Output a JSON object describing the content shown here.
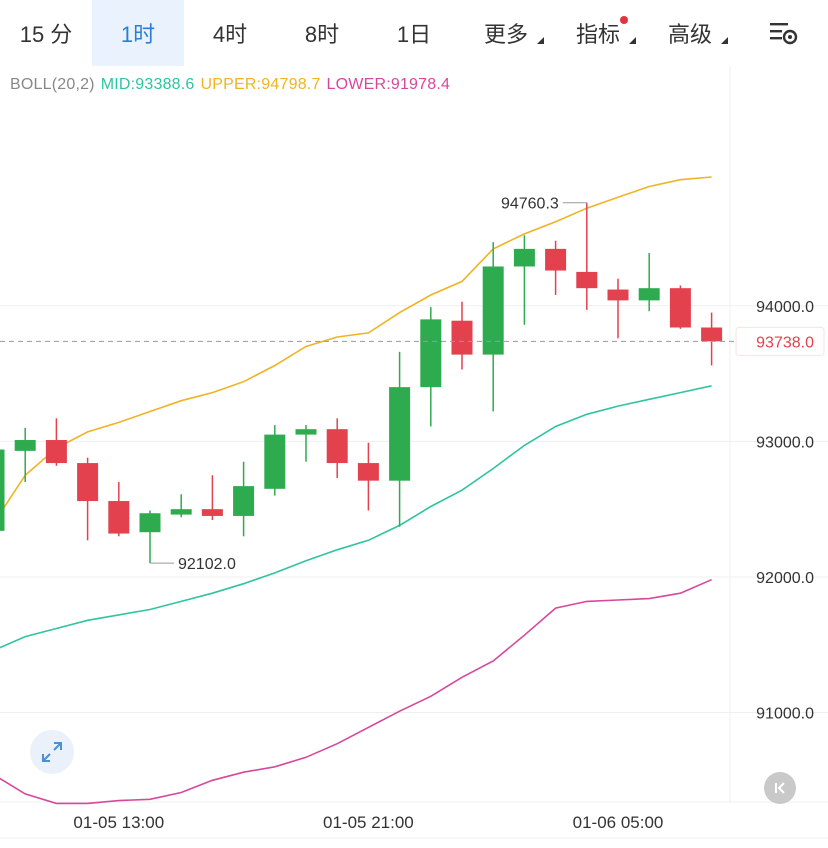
{
  "tabs": [
    {
      "label": "15 分",
      "active": false,
      "has_menu": false,
      "has_dot": false
    },
    {
      "label": "1时",
      "active": true,
      "has_menu": false,
      "has_dot": false
    },
    {
      "label": "4时",
      "active": false,
      "has_menu": false,
      "has_dot": false
    },
    {
      "label": "8时",
      "active": false,
      "has_menu": false,
      "has_dot": false
    },
    {
      "label": "1日",
      "active": false,
      "has_menu": false,
      "has_dot": false
    },
    {
      "label": "更多",
      "active": false,
      "has_menu": true,
      "has_dot": false
    },
    {
      "label": "指标",
      "active": false,
      "has_menu": true,
      "has_dot": true
    },
    {
      "label": "高级",
      "active": false,
      "has_menu": true,
      "has_dot": false
    }
  ],
  "settings_icon": "chart-settings-icon",
  "legend": {
    "name": "BOLL(20,2)",
    "mid": "MID:93388.6",
    "upper": "UPPER:94798.7",
    "lower": "LOWER:91978.4"
  },
  "colors": {
    "up": "#2fab4f",
    "down": "#e4414f",
    "mid": "#2ec4a0",
    "upper": "#f0b323",
    "lower": "#d7479c",
    "grid": "#efefef",
    "axis_text": "#333333",
    "active_tab": "#2a7fd4",
    "dot": "#e5333d",
    "legend_name": "#888888"
  },
  "chart_data": {
    "type": "candlestick",
    "time_labels": [
      {
        "index": 4,
        "label": "01-05 13:00"
      },
      {
        "index": 12,
        "label": "01-05 21:00"
      },
      {
        "index": 20,
        "label": "01-06 05:00"
      }
    ],
    "y_ticks": [
      94000,
      93000,
      92000,
      91000
    ],
    "y_tick_labels": [
      "94000.0",
      "93000.0",
      "92000.0",
      "91000.0"
    ],
    "y_range": [
      90340,
      95400
    ],
    "candles": [
      {
        "o": 92340,
        "h": 93010,
        "l": 92300,
        "c": 92940
      },
      {
        "o": 92930,
        "h": 93100,
        "l": 92700,
        "c": 93010
      },
      {
        "o": 93010,
        "h": 93170,
        "l": 92820,
        "c": 92840
      },
      {
        "o": 92840,
        "h": 92880,
        "l": 92270,
        "c": 92560
      },
      {
        "o": 92560,
        "h": 92700,
        "l": 92300,
        "c": 92320
      },
      {
        "o": 92330,
        "h": 92490,
        "l": 92102,
        "c": 92470
      },
      {
        "o": 92460,
        "h": 92610,
        "l": 92440,
        "c": 92500
      },
      {
        "o": 92500,
        "h": 92750,
        "l": 92420,
        "c": 92450
      },
      {
        "o": 92450,
        "h": 92850,
        "l": 92300,
        "c": 92670
      },
      {
        "o": 92650,
        "h": 93120,
        "l": 92600,
        "c": 93050
      },
      {
        "o": 93050,
        "h": 93120,
        "l": 92850,
        "c": 93090
      },
      {
        "o": 93090,
        "h": 93170,
        "l": 92730,
        "c": 92840
      },
      {
        "o": 92840,
        "h": 92990,
        "l": 92490,
        "c": 92710
      },
      {
        "o": 92710,
        "h": 93660,
        "l": 92370,
        "c": 93400
      },
      {
        "o": 93400,
        "h": 93990,
        "l": 93110,
        "c": 93900
      },
      {
        "o": 93890,
        "h": 94030,
        "l": 93530,
        "c": 93640
      },
      {
        "o": 93640,
        "h": 94470,
        "l": 93220,
        "c": 94290
      },
      {
        "o": 94290,
        "h": 94520,
        "l": 93860,
        "c": 94420
      },
      {
        "o": 94420,
        "h": 94480,
        "l": 94080,
        "c": 94260
      },
      {
        "o": 94250,
        "h": 94760.3,
        "l": 93970,
        "c": 94130
      },
      {
        "o": 94120,
        "h": 94200,
        "l": 93760,
        "c": 94040
      },
      {
        "o": 94040,
        "h": 94390,
        "l": 93960,
        "c": 94130
      },
      {
        "o": 94130,
        "h": 94150,
        "l": 93830,
        "c": 93840
      },
      {
        "o": 93840,
        "h": 93950,
        "l": 93560,
        "c": 93738.0
      }
    ],
    "upper": [
      92400,
      92750,
      92950,
      93070,
      93140,
      93220,
      93300,
      93360,
      93440,
      93560,
      93700,
      93770,
      93800,
      93950,
      94080,
      94180,
      94420,
      94530,
      94620,
      94720,
      94800,
      94880,
      94930,
      94950
    ],
    "mid": [
      91460,
      91560,
      91620,
      91680,
      91720,
      91760,
      91820,
      91880,
      91950,
      92030,
      92120,
      92200,
      92270,
      92380,
      92520,
      92640,
      92800,
      92970,
      93110,
      93200,
      93260,
      93310,
      93360,
      93410
    ],
    "lower": [
      90540,
      90400,
      90330,
      90330,
      90350,
      90360,
      90410,
      90500,
      90560,
      90600,
      90670,
      90770,
      90890,
      91010,
      91120,
      91260,
      91380,
      91570,
      91770,
      91820,
      91830,
      91840,
      91880,
      91980
    ],
    "max_label": "94760.3",
    "min_label": "92102.0",
    "last_price_label": "93738.0"
  }
}
